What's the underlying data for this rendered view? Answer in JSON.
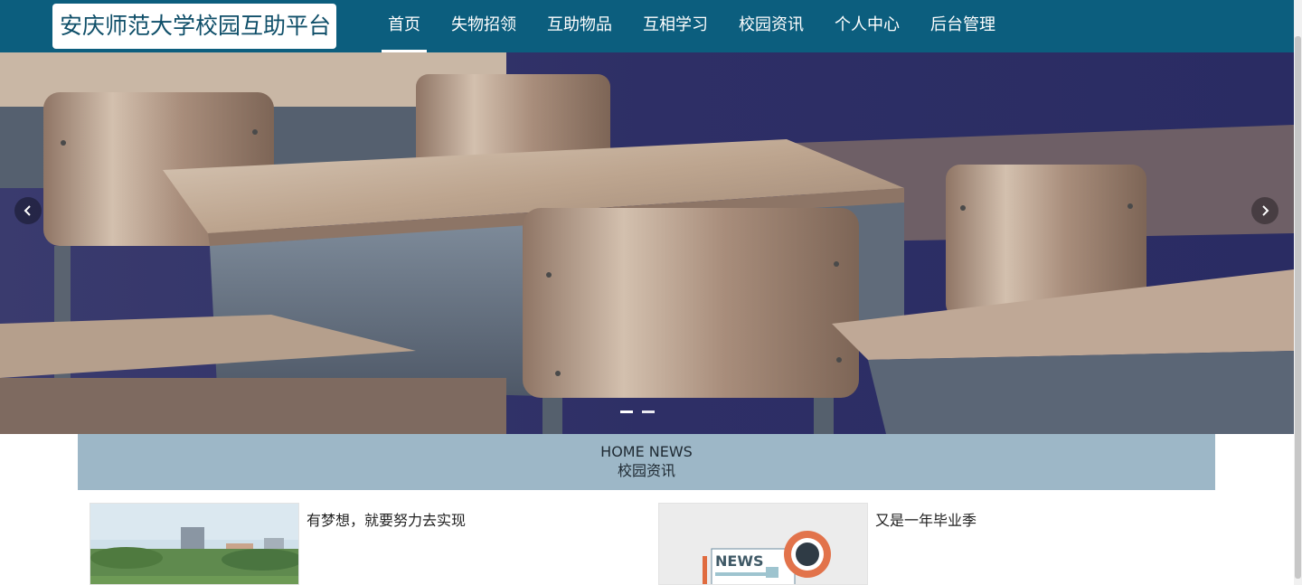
{
  "header": {
    "site_title": "安庆师范大学校园互助平台",
    "nav": [
      {
        "label": "首页",
        "active": true
      },
      {
        "label": "失物招领",
        "active": false
      },
      {
        "label": "互助物品",
        "active": false
      },
      {
        "label": "互相学习",
        "active": false
      },
      {
        "label": "校园资讯",
        "active": false
      },
      {
        "label": "个人中心",
        "active": false
      },
      {
        "label": "后台管理",
        "active": false
      }
    ]
  },
  "carousel": {
    "prev_icon": "chevron-left-icon",
    "next_icon": "chevron-right-icon",
    "slide_count": 2,
    "active_index": 0
  },
  "news_section": {
    "title_en": "HOME NEWS",
    "title_cn": "校园资讯",
    "items": [
      {
        "title": "有梦想，就要努力去实现"
      },
      {
        "title": "又是一年毕业季",
        "thumb_text": "NEWS"
      }
    ]
  },
  "colors": {
    "header_bg": "#0c5e7e",
    "section_bg": "#9db7c7"
  }
}
